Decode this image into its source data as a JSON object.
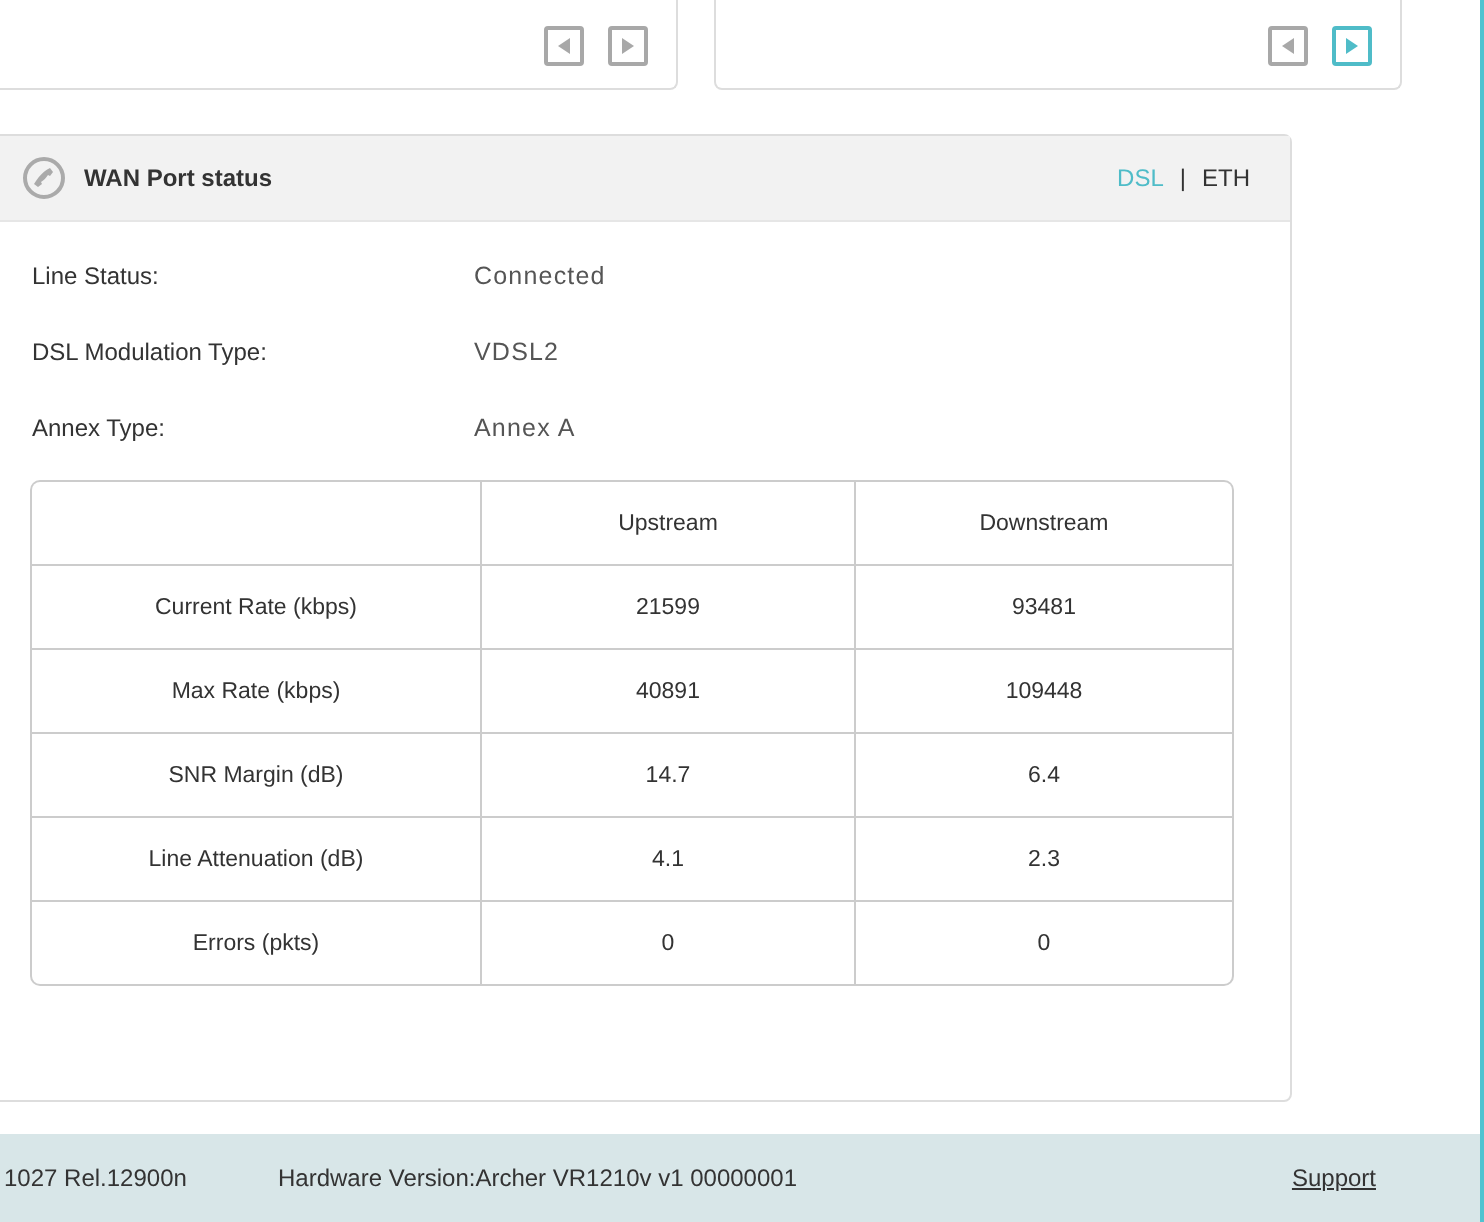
{
  "top_cards": [
    {
      "pager": [
        {
          "kind": "prev",
          "active": false
        },
        {
          "kind": "next",
          "active": false
        }
      ]
    },
    {
      "pager": [
        {
          "kind": "prev",
          "active": false
        },
        {
          "kind": "next",
          "active": true
        }
      ]
    }
  ],
  "wan_panel": {
    "title": "WAN Port status",
    "tabs": [
      {
        "label": "DSL",
        "selected": true
      },
      {
        "label": "ETH",
        "selected": false
      }
    ],
    "separator": "|",
    "fields": [
      {
        "label": "Line Status:",
        "value": "Connected"
      },
      {
        "label": "DSL Modulation Type:",
        "value": "VDSL2"
      },
      {
        "label": "Annex Type:",
        "value": "Annex A"
      }
    ],
    "table": {
      "columns": [
        "",
        "Upstream",
        "Downstream"
      ],
      "rows": [
        [
          "Current Rate (kbps)",
          "21599",
          "93481"
        ],
        [
          "Max Rate (kbps)",
          "40891",
          "109448"
        ],
        [
          "SNR Margin (dB)",
          "14.7",
          "6.4"
        ],
        [
          "Line Attenuation (dB)",
          "4.1",
          "2.3"
        ],
        [
          "Errors (pkts)",
          "0",
          "0"
        ]
      ]
    }
  },
  "footer": {
    "firmware": "1027 Rel.12900n",
    "hardware": "Hardware Version:Archer VR1210v v1 00000001",
    "support_link": "Support"
  }
}
